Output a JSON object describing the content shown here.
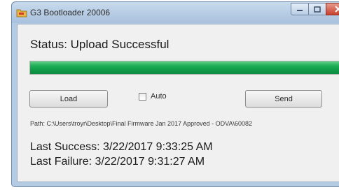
{
  "window": {
    "title": "G3 Bootloader 20006",
    "icon": "app-icon",
    "controls": {
      "minimize": "minimize-icon",
      "maximize": "maximize-icon",
      "close": "close-icon"
    }
  },
  "status": {
    "text": "Status: Upload Successful"
  },
  "progress": {
    "value_percent": 100,
    "color": "#18a552"
  },
  "controls": {
    "load_label": "Load",
    "auto_label": "Auto",
    "auto_checked": false,
    "send_label": "Send"
  },
  "path": {
    "text": "Path: C:\\Users\\troyr\\Desktop\\Final Firmware Jan 2017 Approved - ODVA\\60082"
  },
  "history": {
    "last_success": "Last Success: 3/22/2017 9:33:25 AM",
    "last_failure": "Last Failure: 3/22/2017 9:31:27 AM"
  }
}
